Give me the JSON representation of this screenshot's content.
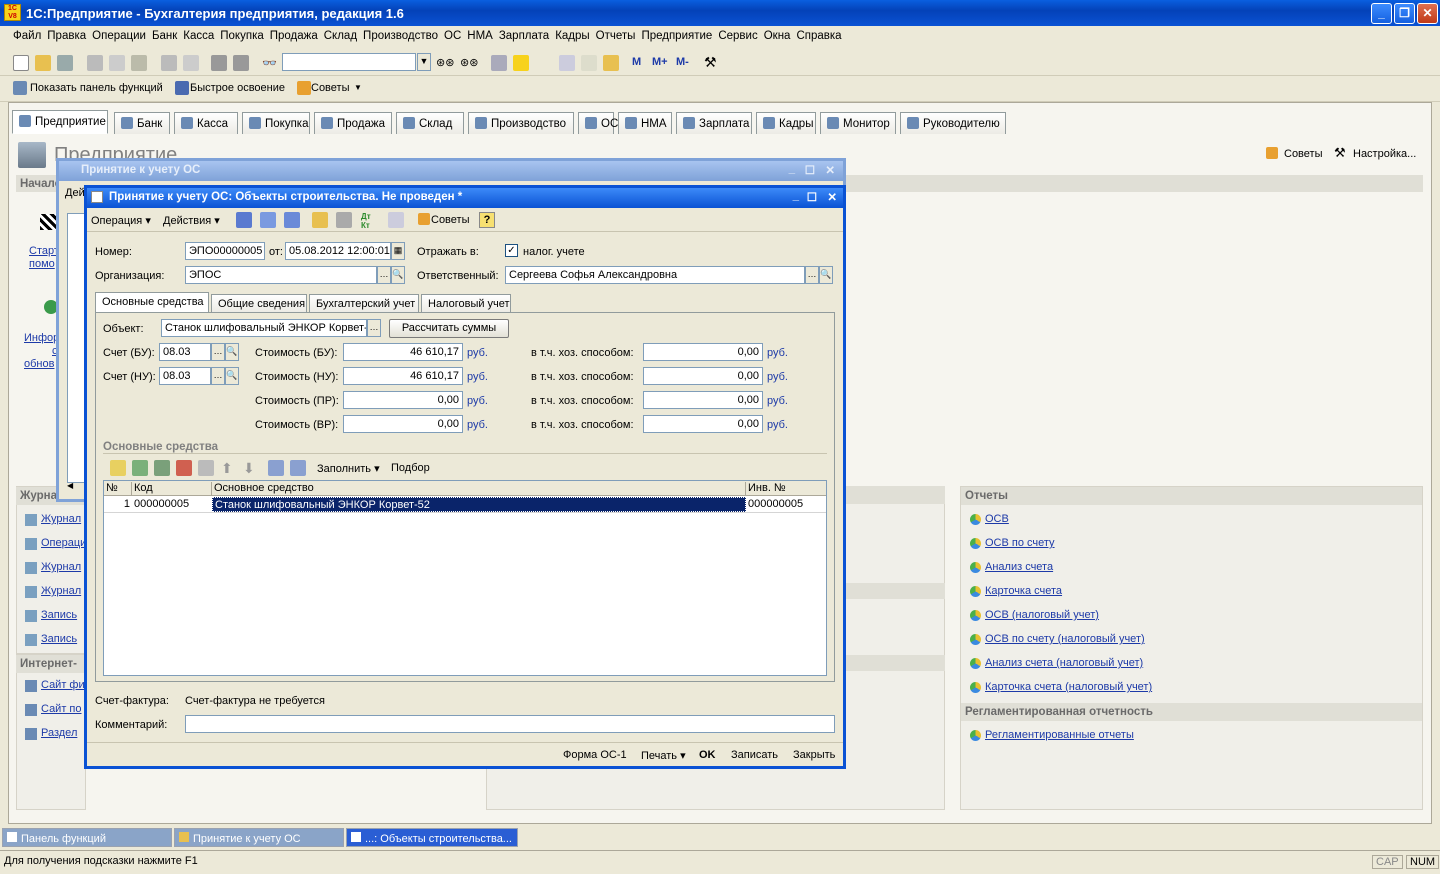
{
  "app": {
    "title": "1С:Предприятие - Бухгалтерия предприятия, редакция 1.6",
    "logo": "1С V8"
  },
  "menu": [
    "Файл",
    "Правка",
    "Операции",
    "Банк",
    "Касса",
    "Покупка",
    "Продажа",
    "Склад",
    "Производство",
    "ОС",
    "НМА",
    "Зарплата",
    "Кадры",
    "Отчеты",
    "Предприятие",
    "Сервис",
    "Окна",
    "Справка"
  ],
  "toolbar2": {
    "show_panel": "Показать панель функций",
    "quick_learn": "Быстрое освоение",
    "tips": "Советы"
  },
  "tabs": [
    "Предприятие",
    "Банк",
    "Касса",
    "Покупка",
    "Продажа",
    "Склад",
    "Производство",
    "ОС",
    "НМА",
    "Зарплата",
    "Кадры",
    "Монитор",
    "Руководителю"
  ],
  "main": {
    "page_title": "Предприятие",
    "tips": "Советы",
    "settings": "Настройка...",
    "start_section": "Начало",
    "start_links": [
      "Старт",
      "помо"
    ],
    "info_links": [
      "Инфор",
      "с",
      "обнов"
    ],
    "journals_header": "Журнал",
    "journals": [
      "Журнал",
      "Операци",
      "Журнал",
      "Журнал",
      "Запись",
      "Запись"
    ],
    "internet_header": "Интернет-",
    "internet": [
      "Сайт фи",
      "Сайт по",
      "Раздел"
    ],
    "reports_header": "Отчеты",
    "reports": [
      "ОСВ",
      "ОСВ по счету",
      "Анализ счета",
      "Карточка счета",
      "ОСВ (налоговый учет)",
      "ОСВ по счету (налоговый учет)",
      "Анализ счета (налоговый учет)",
      "Карточка счета (налоговый учет)"
    ],
    "reg_header": "Регламентированная отчетность",
    "reg_links": [
      "Регламентированные отчеты"
    ]
  },
  "bg_window": {
    "title": "Принятие к учету ОС",
    "tab_stub": "Дей"
  },
  "doc": {
    "title": "Принятие к учету ОС: Объекты строительства. Не проведен *",
    "tb": {
      "operation": "Операция",
      "actions": "Действия",
      "tips": "Советы",
      "help": "?"
    },
    "number_label": "Номер:",
    "number": "ЭПО00000005",
    "date_label": "от:",
    "date": "05.08.2012 12:00:01",
    "reflect_label": "Отражать в:",
    "tax_label": "налог. учете",
    "tax_checked": true,
    "org_label": "Организация:",
    "org": "ЭПОС",
    "resp_label": "Ответственный:",
    "resp": "Сергеева Софья Александровна",
    "inner_tabs": [
      "Основные средства",
      "Общие сведения",
      "Бухгалтерский учет",
      "Налоговый учет"
    ],
    "object_label": "Объект:",
    "object": "Станок шлифовальный ЭНКОР Корвет-",
    "calc_btn": "Рассчитать суммы",
    "acc_bu_label": "Счет (БУ):",
    "acc_bu": "08.03",
    "acc_nu_label": "Счет (НУ):",
    "acc_nu": "08.03",
    "costs": [
      {
        "label": "Стоимость (БУ):",
        "value": "46 610,17",
        "unit": "руб.",
        "hx_label": "в т.ч. хоз. способом:",
        "hx": "0,00",
        "hx_unit": "руб."
      },
      {
        "label": "Стоимость (НУ):",
        "value": "46 610,17",
        "unit": "руб.",
        "hx_label": "в т.ч. хоз. способом:",
        "hx": "0,00",
        "hx_unit": "руб."
      },
      {
        "label": "Стоимость (ПР):",
        "value": "0,00",
        "unit": "руб.",
        "hx_label": "в т.ч. хоз. способом:",
        "hx": "0,00",
        "hx_unit": "руб."
      },
      {
        "label": "Стоимость (ВР):",
        "value": "0,00",
        "unit": "руб.",
        "hx_label": "в т.ч. хоз. способом:",
        "hx": "0,00",
        "hx_unit": "руб."
      }
    ],
    "os_section": "Основные средства",
    "fill_btn": "Заполнить",
    "select_btn": "Подбор",
    "grid_headers": [
      "№",
      "Код",
      "Основное средство",
      "Инв. №"
    ],
    "grid_rows": [
      {
        "n": "1",
        "code": "000000005",
        "name": "Станок шлифовальный ЭНКОР Корвет-52",
        "inv": "000000005"
      }
    ],
    "invoice_label": "Счет-фактура:",
    "invoice_value": "Счет-фактура не требуется",
    "comment_label": "Комментарий:",
    "comment": "",
    "bottom": {
      "form": "Форма ОС-1",
      "print": "Печать",
      "ok": "OK",
      "save": "Записать",
      "close": "Закрыть"
    }
  },
  "taskbar": [
    "Панель функций",
    "Принятие к учету ОС",
    "...: Объекты строительства..."
  ],
  "status": {
    "hint": "Для получения подсказки нажмите F1",
    "cap": "CAP",
    "num": "NUM"
  }
}
